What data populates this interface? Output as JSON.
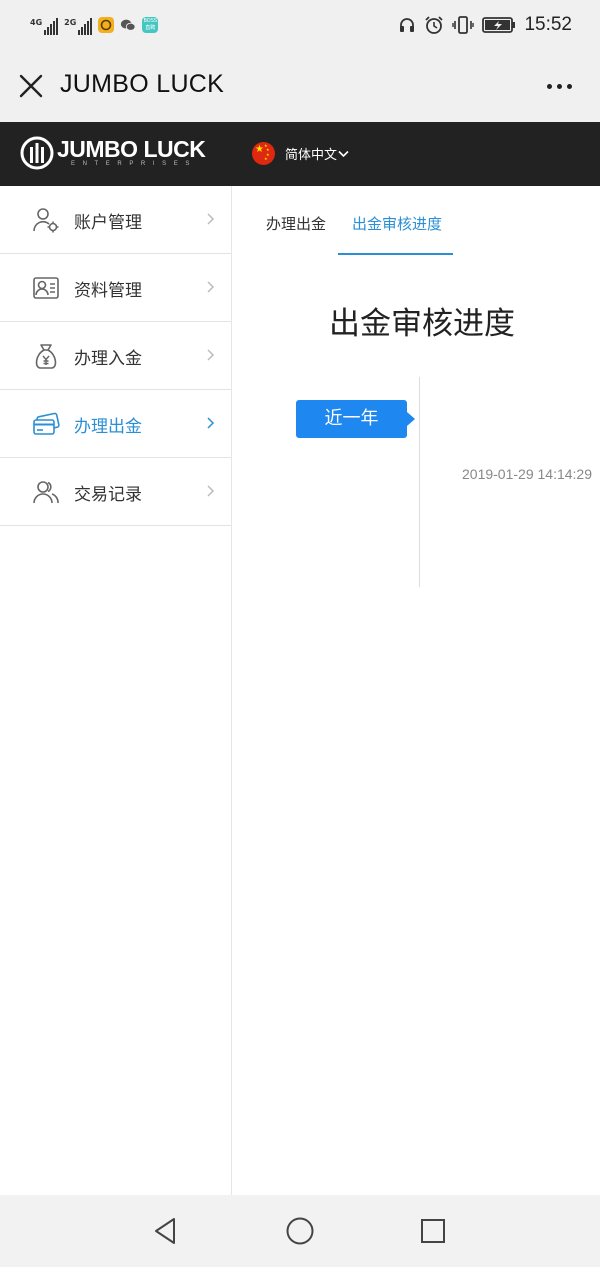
{
  "status_bar": {
    "sim1": "4G",
    "sim2": "2G",
    "app_badge": "BOSS\n直聘",
    "time": "15:52"
  },
  "title_bar": {
    "title": "JUMBO LUCK"
  },
  "site_header": {
    "logo_main": "JUMBO LUCK",
    "logo_sub": "ENTERPRISES",
    "language": "简体中文"
  },
  "sidebar": {
    "items": [
      {
        "label": "账户管理",
        "icon": "user-settings-icon"
      },
      {
        "label": "资料管理",
        "icon": "id-card-icon"
      },
      {
        "label": "办理入金",
        "icon": "money-bag-icon"
      },
      {
        "label": "办理出金",
        "icon": "bank-card-icon",
        "active": true
      },
      {
        "label": "交易记录",
        "icon": "users-icon"
      }
    ],
    "active_color": "#2a8fd4"
  },
  "tabs": [
    {
      "label": "办理出金"
    },
    {
      "label": "出金审核进度",
      "active": true
    }
  ],
  "main": {
    "heading": "出金审核进度",
    "period_label": "近一年",
    "records": [
      {
        "time": "2019-01-29 14:14:29"
      }
    ]
  },
  "colors": {
    "accent": "#2a8fd4",
    "badge": "#1e88f0",
    "header_bg": "#222222"
  }
}
